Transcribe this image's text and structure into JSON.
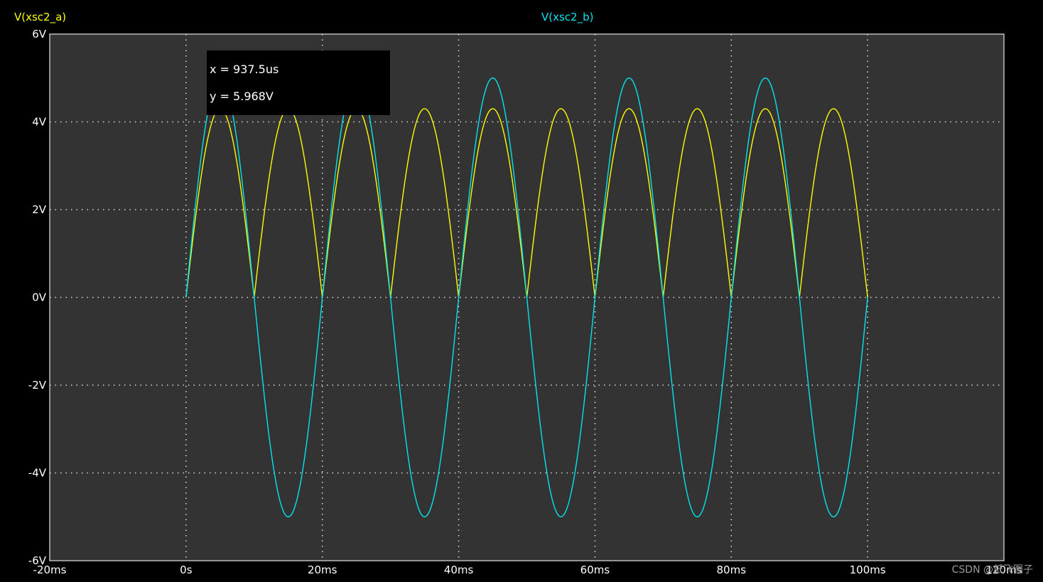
{
  "chart_data": {
    "type": "line",
    "x_unit": "ms",
    "y_unit": "V",
    "xlim": [
      -20,
      120
    ],
    "ylim": [
      -6,
      6
    ],
    "grid": true,
    "x_ticks": [
      -20,
      0,
      20,
      40,
      60,
      80,
      100,
      120
    ],
    "x_tick_labels": [
      "-20ms",
      "0s",
      "20ms",
      "40ms",
      "60ms",
      "80ms",
      "100ms",
      "120ms"
    ],
    "y_ticks": [
      6,
      4,
      2,
      0,
      -2,
      -4,
      -6
    ],
    "y_tick_labels": [
      "6V",
      "4V",
      "2V",
      "0V",
      "-2V",
      "-4V",
      "-6V"
    ],
    "series": [
      {
        "name": "V(xsc2_a)",
        "color": "#ffff00",
        "shape": "full-wave rectified sine",
        "amplitude": 4.3,
        "period_ms": 20,
        "x_start": 0,
        "x_end": 100,
        "x": [
          0,
          5,
          10,
          15,
          20,
          25,
          30,
          35,
          40,
          45,
          50,
          55,
          60,
          65,
          70,
          75,
          80,
          85,
          90,
          95,
          100
        ],
        "y": [
          0,
          4.3,
          0,
          4.3,
          0,
          4.3,
          0,
          4.3,
          0,
          4.3,
          0,
          4.3,
          0,
          4.3,
          0,
          4.3,
          0,
          4.3,
          0,
          4.3,
          0
        ]
      },
      {
        "name": "V(xsc2_b)",
        "color": "#00e5ee",
        "shape": "sine",
        "amplitude": 5.0,
        "period_ms": 20,
        "x_start": 0,
        "x_end": 100,
        "x": [
          0,
          5,
          10,
          15,
          20,
          25,
          30,
          35,
          40,
          45,
          50,
          55,
          60,
          65,
          70,
          75,
          80,
          85,
          90,
          95,
          100
        ],
        "y": [
          0,
          5,
          0,
          -5,
          0,
          5,
          0,
          -5,
          0,
          5,
          0,
          -5,
          0,
          5,
          0,
          -5,
          0,
          5,
          0,
          -5,
          0
        ]
      }
    ],
    "cursor": {
      "x_label": "x = 937.5us",
      "y_label": "y = 5.968V"
    }
  },
  "watermark": "CSDN @纸飞图子",
  "colors": {
    "background": "#000000",
    "plot_area": "#333333",
    "grid": "#d8d8d8",
    "text": "#ffffff",
    "cursor_box": "#000000"
  }
}
